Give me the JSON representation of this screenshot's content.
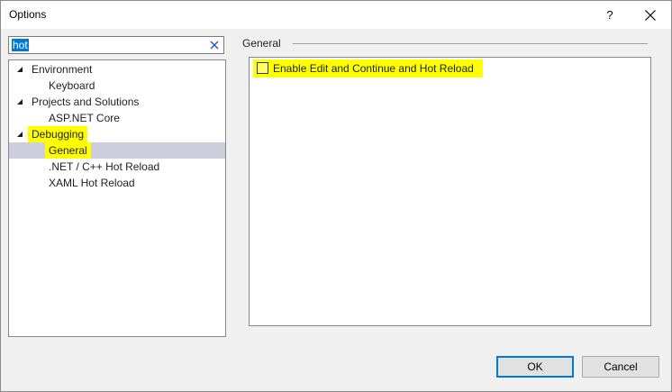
{
  "window": {
    "title": "Options",
    "help_label": "?"
  },
  "search": {
    "value": "hot"
  },
  "tree": {
    "items": [
      {
        "label": "Environment",
        "level": 0,
        "expanded": true
      },
      {
        "label": "Keyboard",
        "level": 1
      },
      {
        "label": "Projects and Solutions",
        "level": 0,
        "expanded": true
      },
      {
        "label": "ASP.NET Core",
        "level": 1
      },
      {
        "label": "Debugging",
        "level": 0,
        "expanded": true,
        "highlighted": true
      },
      {
        "label": "General",
        "level": 1,
        "selected": true,
        "highlighted": true
      },
      {
        "label": ".NET / C++ Hot Reload",
        "level": 1
      },
      {
        "label": "XAML Hot Reload",
        "level": 1
      }
    ]
  },
  "panel": {
    "group_label": "General",
    "option_label": "Enable Edit and Continue and Hot Reload",
    "option_checked": false
  },
  "buttons": {
    "ok_label": "OK",
    "cancel_label": "Cancel"
  },
  "colors": {
    "highlight": "#ffff00",
    "selection": "#cccedb",
    "accent": "#0078d7"
  }
}
